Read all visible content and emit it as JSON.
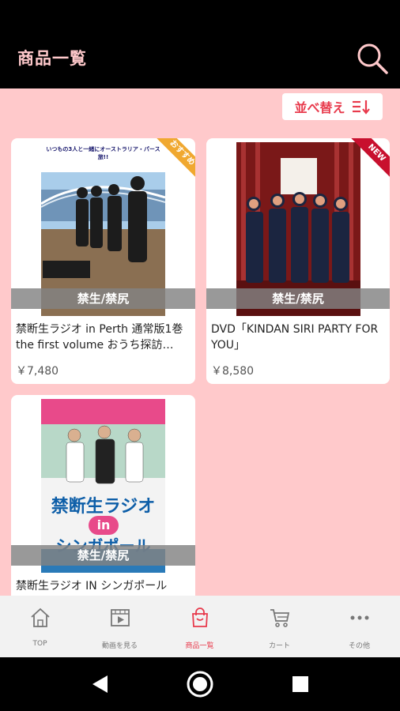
{
  "header": {
    "title": "商品一覧"
  },
  "sort": {
    "label": "並べ替え"
  },
  "products": [
    {
      "artist": "禁生/禁尻",
      "title": "禁断生ラジオ in Perth 通常版1巻 the first volume おうち探訪…",
      "price": "￥7,480",
      "badge": "おすすめ",
      "badge_color": "#f0a830",
      "cover_banner": "いつもの3人と一緒にオーストラリア・パース旅!!"
    },
    {
      "artist": "禁生/禁尻",
      "title": "DVD「KINDAN SIRI PARTY FOR YOU」",
      "price": "￥8,580",
      "badge": "NEW",
      "badge_color": "#c8102e"
    },
    {
      "artist": "禁生/禁尻",
      "title": "禁断生ラジオ IN シンガポール",
      "price": "",
      "cover_title": "禁断生ラジオ",
      "cover_sub": "in",
      "cover_sub2": "シンガポール"
    }
  ],
  "nav": [
    {
      "label": "TOP",
      "icon": "home-icon"
    },
    {
      "label": "動画を見る",
      "icon": "video-icon"
    },
    {
      "label": "商品一覧",
      "icon": "shopping-bag-icon",
      "active": true
    },
    {
      "label": "カート",
      "icon": "cart-icon"
    },
    {
      "label": "その他",
      "icon": "more-icon"
    }
  ],
  "colors": {
    "accent": "#e83a4c",
    "background": "#ffc9cb",
    "header": "#000000"
  }
}
